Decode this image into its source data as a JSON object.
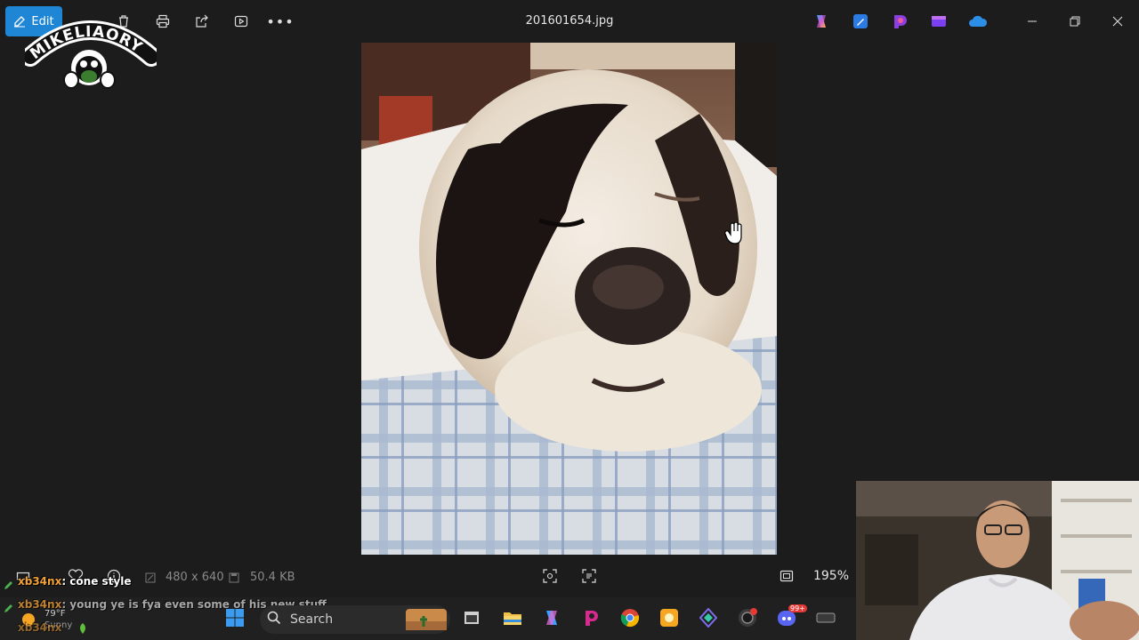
{
  "toolbar": {
    "edit_label": "Edit",
    "filename": "201601654.jpg"
  },
  "logo": {
    "text": "MIKELIAORY"
  },
  "info": {
    "dimensions": "480 x 640",
    "file_size": "50.4 KB",
    "zoom": "195%"
  },
  "chat": {
    "messages": [
      {
        "user": "xb34nx",
        "text": ": cone style"
      },
      {
        "user": "xb34nx",
        "text": ": young ye is fya even some of his new stuff"
      }
    ],
    "weather": "79°F",
    "weather_desc": "Sunny",
    "user3": "xb34nx"
  },
  "taskbar": {
    "search_placeholder": "Search",
    "notification_badge": "99+"
  },
  "colors": {
    "accent": "#1f86d6",
    "background": "#1c1c1c",
    "taskbar": "#202020",
    "chat_user": "#f4a236"
  }
}
